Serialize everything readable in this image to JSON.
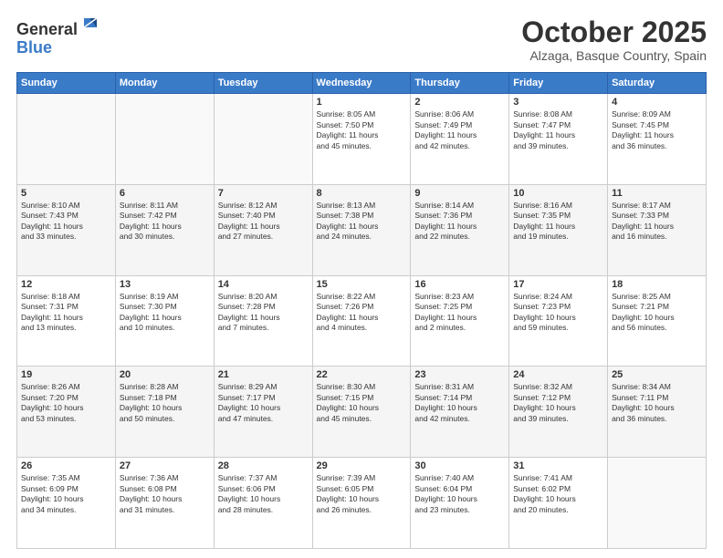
{
  "header": {
    "logo_general": "General",
    "logo_blue": "Blue",
    "month": "October 2025",
    "location": "Alzaga, Basque Country, Spain"
  },
  "days_of_week": [
    "Sunday",
    "Monday",
    "Tuesday",
    "Wednesday",
    "Thursday",
    "Friday",
    "Saturday"
  ],
  "weeks": [
    [
      {
        "day": "",
        "info": ""
      },
      {
        "day": "",
        "info": ""
      },
      {
        "day": "",
        "info": ""
      },
      {
        "day": "1",
        "info": "Sunrise: 8:05 AM\nSunset: 7:50 PM\nDaylight: 11 hours\nand 45 minutes."
      },
      {
        "day": "2",
        "info": "Sunrise: 8:06 AM\nSunset: 7:49 PM\nDaylight: 11 hours\nand 42 minutes."
      },
      {
        "day": "3",
        "info": "Sunrise: 8:08 AM\nSunset: 7:47 PM\nDaylight: 11 hours\nand 39 minutes."
      },
      {
        "day": "4",
        "info": "Sunrise: 8:09 AM\nSunset: 7:45 PM\nDaylight: 11 hours\nand 36 minutes."
      }
    ],
    [
      {
        "day": "5",
        "info": "Sunrise: 8:10 AM\nSunset: 7:43 PM\nDaylight: 11 hours\nand 33 minutes."
      },
      {
        "day": "6",
        "info": "Sunrise: 8:11 AM\nSunset: 7:42 PM\nDaylight: 11 hours\nand 30 minutes."
      },
      {
        "day": "7",
        "info": "Sunrise: 8:12 AM\nSunset: 7:40 PM\nDaylight: 11 hours\nand 27 minutes."
      },
      {
        "day": "8",
        "info": "Sunrise: 8:13 AM\nSunset: 7:38 PM\nDaylight: 11 hours\nand 24 minutes."
      },
      {
        "day": "9",
        "info": "Sunrise: 8:14 AM\nSunset: 7:36 PM\nDaylight: 11 hours\nand 22 minutes."
      },
      {
        "day": "10",
        "info": "Sunrise: 8:16 AM\nSunset: 7:35 PM\nDaylight: 11 hours\nand 19 minutes."
      },
      {
        "day": "11",
        "info": "Sunrise: 8:17 AM\nSunset: 7:33 PM\nDaylight: 11 hours\nand 16 minutes."
      }
    ],
    [
      {
        "day": "12",
        "info": "Sunrise: 8:18 AM\nSunset: 7:31 PM\nDaylight: 11 hours\nand 13 minutes."
      },
      {
        "day": "13",
        "info": "Sunrise: 8:19 AM\nSunset: 7:30 PM\nDaylight: 11 hours\nand 10 minutes."
      },
      {
        "day": "14",
        "info": "Sunrise: 8:20 AM\nSunset: 7:28 PM\nDaylight: 11 hours\nand 7 minutes."
      },
      {
        "day": "15",
        "info": "Sunrise: 8:22 AM\nSunset: 7:26 PM\nDaylight: 11 hours\nand 4 minutes."
      },
      {
        "day": "16",
        "info": "Sunrise: 8:23 AM\nSunset: 7:25 PM\nDaylight: 11 hours\nand 2 minutes."
      },
      {
        "day": "17",
        "info": "Sunrise: 8:24 AM\nSunset: 7:23 PM\nDaylight: 10 hours\nand 59 minutes."
      },
      {
        "day": "18",
        "info": "Sunrise: 8:25 AM\nSunset: 7:21 PM\nDaylight: 10 hours\nand 56 minutes."
      }
    ],
    [
      {
        "day": "19",
        "info": "Sunrise: 8:26 AM\nSunset: 7:20 PM\nDaylight: 10 hours\nand 53 minutes."
      },
      {
        "day": "20",
        "info": "Sunrise: 8:28 AM\nSunset: 7:18 PM\nDaylight: 10 hours\nand 50 minutes."
      },
      {
        "day": "21",
        "info": "Sunrise: 8:29 AM\nSunset: 7:17 PM\nDaylight: 10 hours\nand 47 minutes."
      },
      {
        "day": "22",
        "info": "Sunrise: 8:30 AM\nSunset: 7:15 PM\nDaylight: 10 hours\nand 45 minutes."
      },
      {
        "day": "23",
        "info": "Sunrise: 8:31 AM\nSunset: 7:14 PM\nDaylight: 10 hours\nand 42 minutes."
      },
      {
        "day": "24",
        "info": "Sunrise: 8:32 AM\nSunset: 7:12 PM\nDaylight: 10 hours\nand 39 minutes."
      },
      {
        "day": "25",
        "info": "Sunrise: 8:34 AM\nSunset: 7:11 PM\nDaylight: 10 hours\nand 36 minutes."
      }
    ],
    [
      {
        "day": "26",
        "info": "Sunrise: 7:35 AM\nSunset: 6:09 PM\nDaylight: 10 hours\nand 34 minutes."
      },
      {
        "day": "27",
        "info": "Sunrise: 7:36 AM\nSunset: 6:08 PM\nDaylight: 10 hours\nand 31 minutes."
      },
      {
        "day": "28",
        "info": "Sunrise: 7:37 AM\nSunset: 6:06 PM\nDaylight: 10 hours\nand 28 minutes."
      },
      {
        "day": "29",
        "info": "Sunrise: 7:39 AM\nSunset: 6:05 PM\nDaylight: 10 hours\nand 26 minutes."
      },
      {
        "day": "30",
        "info": "Sunrise: 7:40 AM\nSunset: 6:04 PM\nDaylight: 10 hours\nand 23 minutes."
      },
      {
        "day": "31",
        "info": "Sunrise: 7:41 AM\nSunset: 6:02 PM\nDaylight: 10 hours\nand 20 minutes."
      },
      {
        "day": "",
        "info": ""
      }
    ]
  ]
}
